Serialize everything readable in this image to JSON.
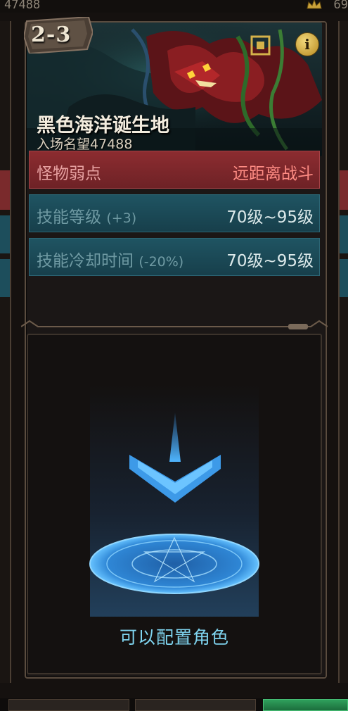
{
  "top": {
    "left_value": "47488",
    "right_value": "69"
  },
  "stage": {
    "id": "2-3",
    "title": "黑色海洋诞生地",
    "reputation_label": "入场名望",
    "reputation_value": "47488",
    "info_icon": "i"
  },
  "rows": {
    "weakness_label": "怪物弱点",
    "weakness_value": "远距离战斗",
    "skill_label": "技能等级",
    "skill_mod": "(+3)",
    "skill_value": "70级~95级",
    "cooldown_label": "技能冷却时间",
    "cooldown_mod": "(-20%)",
    "cooldown_value": "70级~95级"
  },
  "slot": {
    "text": "可以配置角色",
    "icon": "down-arrow-summon-circle-icon"
  },
  "colors": {
    "weakness_bg": "#8c2c30",
    "info_bg": "#1f5462",
    "slot_text": "#7fd4ef"
  }
}
